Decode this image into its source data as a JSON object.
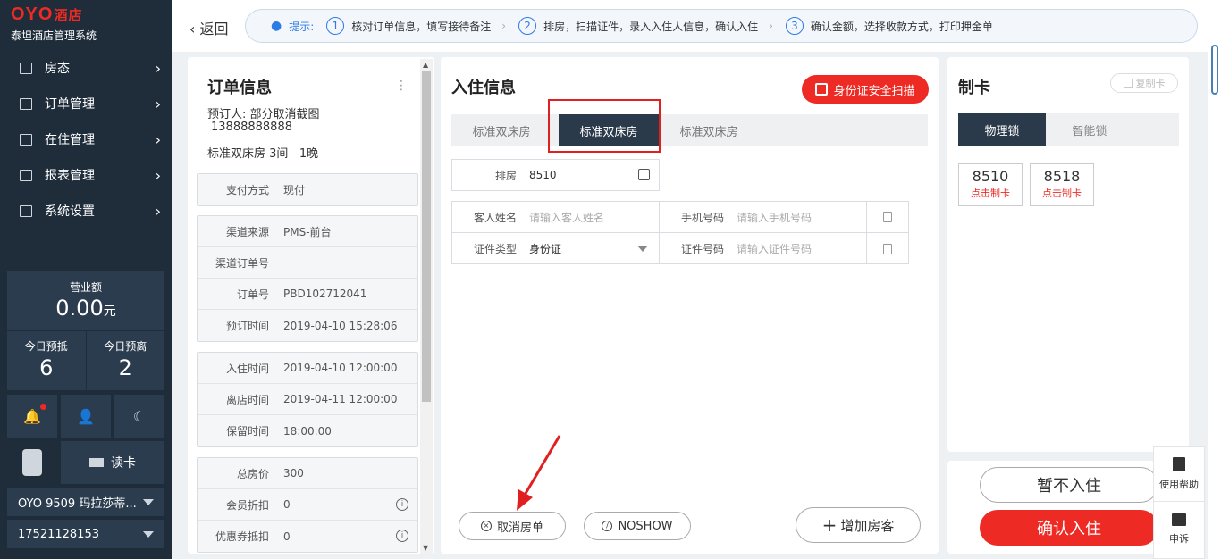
{
  "brand": {
    "logo": "OYO",
    "logo_cn": "酒店",
    "subtitle": "泰坦酒店管理系统"
  },
  "nav": [
    {
      "label": "房态",
      "icon": "grid-icon"
    },
    {
      "label": "订单管理",
      "icon": "list-icon"
    },
    {
      "label": "在住管理",
      "icon": "bed-icon"
    },
    {
      "label": "报表管理",
      "icon": "chart-icon"
    },
    {
      "label": "系统设置",
      "icon": "monitor-icon"
    }
  ],
  "revenue": {
    "label": "营业额",
    "amount": "0.00",
    "unit": "元"
  },
  "today": {
    "arrive_label": "今日预抵",
    "arrive": "6",
    "depart_label": "今日预离",
    "depart": "2"
  },
  "read_card": "读卡",
  "hotel_select": "OYO 9509 玛拉莎蒂...",
  "phone_select": "17521128153",
  "topbar": {
    "back": "返回",
    "tip_label": "提示:",
    "steps": [
      {
        "num": "1",
        "text": "核对订单信息，填写接待备注"
      },
      {
        "num": "2",
        "text": "排房，扫描证件，录入入住人信息，确认入住"
      },
      {
        "num": "3",
        "text": "确认金额，选择收款方式，打印押金单"
      }
    ]
  },
  "order": {
    "title": "订单信息",
    "booker": "预订人: 部分取消截图",
    "booker_phone": "13888888888",
    "room_type": "标准双床房",
    "rooms": "3间",
    "nights": "1晚",
    "group1": [
      {
        "k": "支付方式",
        "v": "现付"
      }
    ],
    "group2": [
      {
        "k": "渠道来源",
        "v": "PMS-前台"
      },
      {
        "k": "渠道订单号",
        "v": ""
      },
      {
        "k": "订单号",
        "v": "PBD102712041"
      },
      {
        "k": "预订时间",
        "v": "2019-04-10 15:28:06"
      }
    ],
    "group3": [
      {
        "k": "入住时间",
        "v": "2019-04-10 12:00:00"
      },
      {
        "k": "离店时间",
        "v": "2019-04-11 12:00:00"
      },
      {
        "k": "保留时间",
        "v": "18:00:00"
      }
    ],
    "group4": [
      {
        "k": "总房价",
        "v": "300"
      },
      {
        "k": "会员折扣",
        "v": "0"
      },
      {
        "k": "优惠券抵扣",
        "v": "0"
      }
    ]
  },
  "checkin": {
    "title": "入住信息",
    "id_scan": "身份证安全扫描",
    "tabs": [
      "标准双床房",
      "标准双床房",
      "标准双床房"
    ],
    "room_label": "排房",
    "room_value": "8510",
    "guest_name_label": "客人姓名",
    "guest_name_ph": "请输入客人姓名",
    "phone_label": "手机号码",
    "phone_ph": "请输入手机号码",
    "id_type_label": "证件类型",
    "id_type_value": "身份证",
    "id_no_label": "证件号码",
    "id_no_ph": "请输入证件号码",
    "cancel_btn": "取消房单",
    "noshow_btn": "NOSHOW",
    "add_guest_btn": "增加房客"
  },
  "makecard": {
    "title": "制卡",
    "copy": "复制卡",
    "tabs": [
      "物理锁",
      "智能锁"
    ],
    "cards": [
      {
        "room": "8510",
        "action": "点击制卡"
      },
      {
        "room": "8518",
        "action": "点击制卡"
      }
    ]
  },
  "actions": {
    "pending": "暂不入住",
    "confirm": "确认入住"
  },
  "helper": {
    "help": "使用帮助",
    "appeal": "申诉"
  },
  "colors": {
    "accent_red": "#ee2a24",
    "sidebar": "#1f2d3b",
    "tab_active": "#2b3a4a",
    "tip_blue": "#2d7be5"
  }
}
